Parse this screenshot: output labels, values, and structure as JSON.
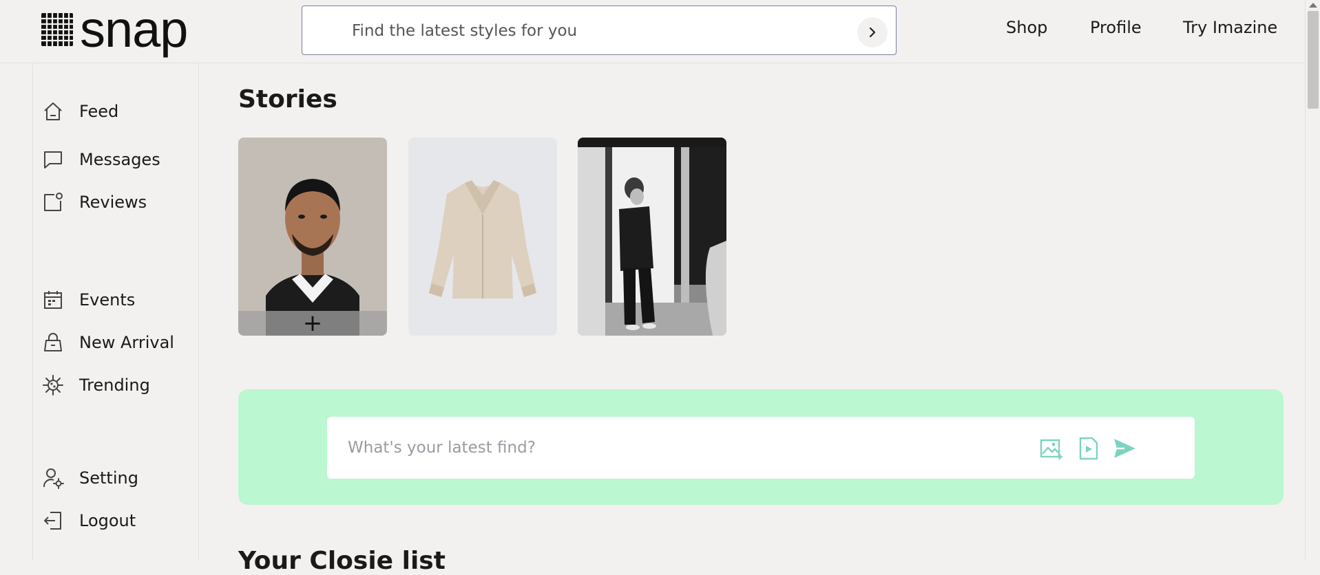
{
  "header": {
    "logo_text": "snap",
    "search_placeholder": "Find the latest styles for you",
    "nav": [
      "Shop",
      "Profile",
      "Try Imazine"
    ]
  },
  "sidebar": {
    "items": [
      {
        "label": "Feed",
        "icon": "home-icon"
      },
      {
        "label": "Messages",
        "icon": "message-icon"
      },
      {
        "label": "Reviews",
        "icon": "review-icon"
      },
      {
        "label": "Events",
        "icon": "calendar-icon"
      },
      {
        "label": "New Arrival",
        "icon": "bag-icon"
      },
      {
        "label": "Trending",
        "icon": "trending-icon"
      },
      {
        "label": "Setting",
        "icon": "user-settings-icon"
      },
      {
        "label": "Logout",
        "icon": "logout-icon"
      }
    ]
  },
  "main": {
    "stories_title": "Stories",
    "stories": [
      {
        "type": "own-story",
        "add_symbol": "+"
      },
      {
        "type": "story"
      },
      {
        "type": "story"
      }
    ],
    "post": {
      "placeholder": "What's your latest find?",
      "icons": [
        "add-image-icon",
        "add-video-icon",
        "send-icon"
      ]
    },
    "next_section_title": "Your Closie list"
  },
  "colors": {
    "background": "#f2f1ef",
    "post_box": "#bbf7d0",
    "post_icons": "#7dd3c0"
  }
}
